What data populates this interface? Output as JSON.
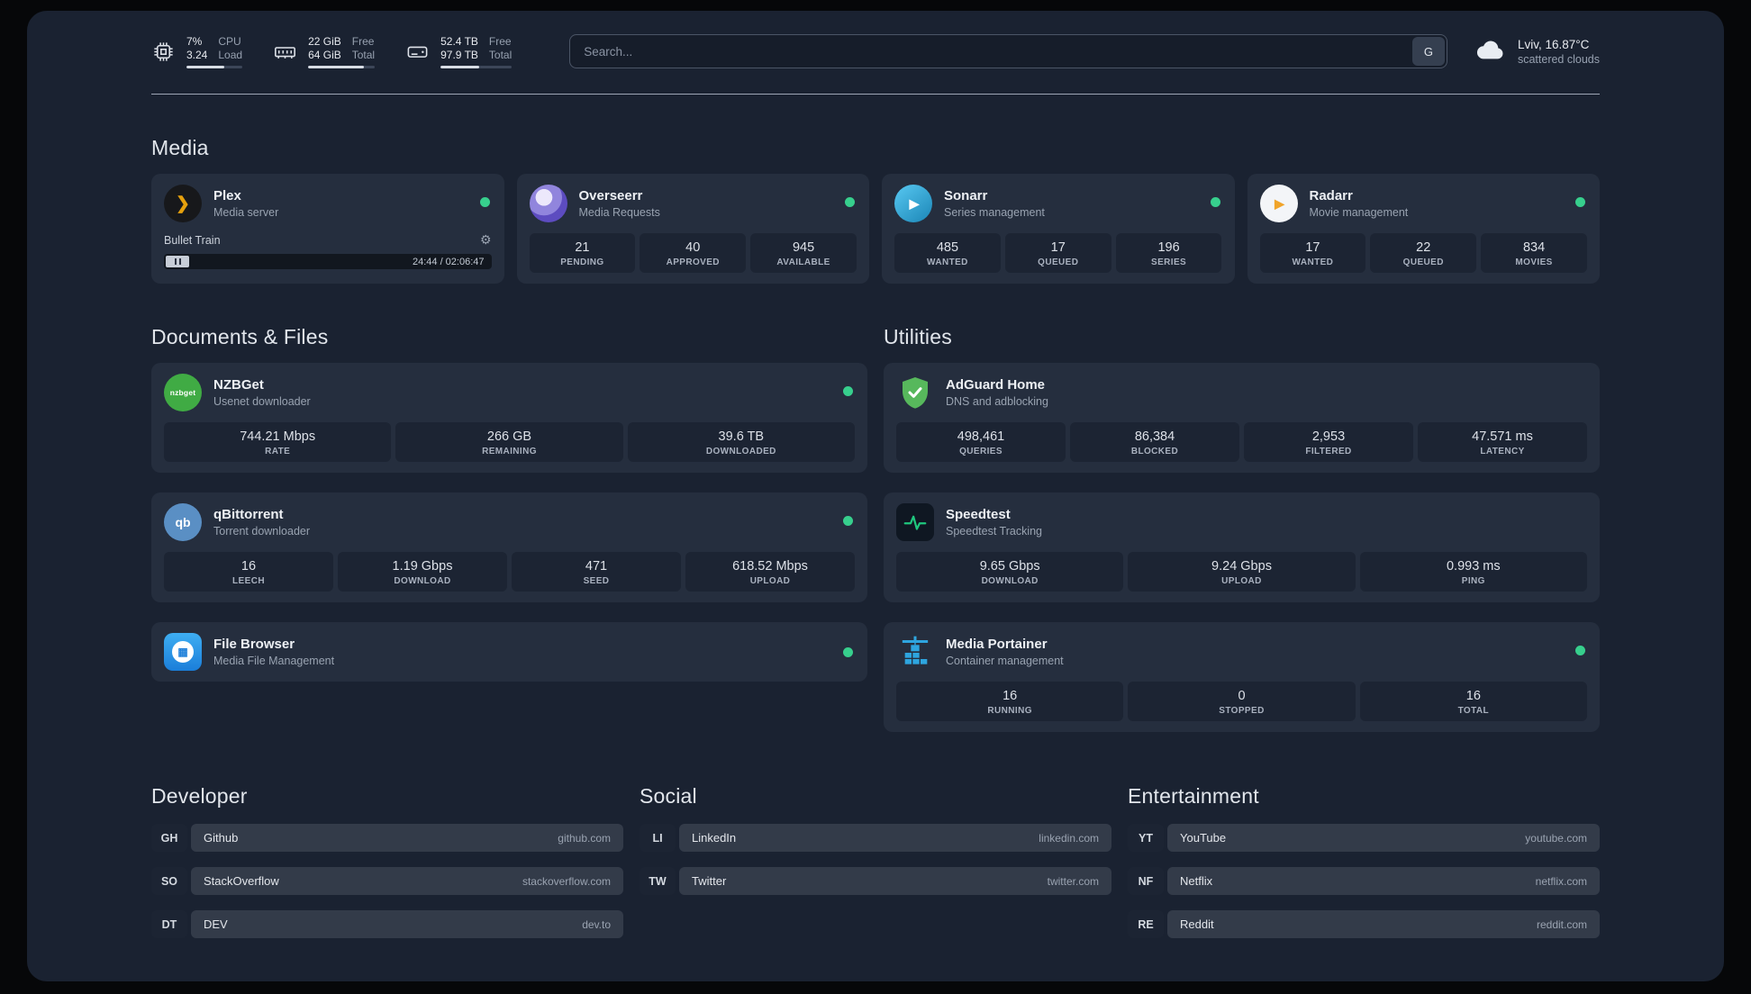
{
  "system": {
    "cpu": {
      "value1": "7%",
      "value2": "3.24",
      "label1": "CPU",
      "label2": "Load",
      "progress": 68
    },
    "memory": {
      "value1": "22 GiB",
      "value2": "64 GiB",
      "label1": "Free",
      "label2": "Total",
      "progress": 84
    },
    "disk": {
      "value1": "52.4 TB",
      "value2": "97.9 TB",
      "label1": "Free",
      "label2": "Total",
      "progress": 54
    }
  },
  "search": {
    "placeholder": "Search...",
    "button_label": "G"
  },
  "weather": {
    "location": "Lviv, 16.87°C",
    "condition": "scattered clouds"
  },
  "groups": {
    "media": {
      "title": "Media"
    },
    "documents": {
      "title": "Documents & Files"
    },
    "utilities": {
      "title": "Utilities"
    }
  },
  "services": {
    "plex": {
      "name": "Plex",
      "subtitle": "Media server",
      "player": {
        "track": "Bullet Train",
        "time": "24:44 / 02:06:47"
      }
    },
    "overseerr": {
      "name": "Overseerr",
      "subtitle": "Media Requests",
      "stats": [
        {
          "value": "21",
          "label": "PENDING"
        },
        {
          "value": "40",
          "label": "APPROVED"
        },
        {
          "value": "945",
          "label": "AVAILABLE"
        }
      ]
    },
    "sonarr": {
      "name": "Sonarr",
      "subtitle": "Series management",
      "stats": [
        {
          "value": "485",
          "label": "WANTED"
        },
        {
          "value": "17",
          "label": "QUEUED"
        },
        {
          "value": "196",
          "label": "SERIES"
        }
      ]
    },
    "radarr": {
      "name": "Radarr",
      "subtitle": "Movie management",
      "stats": [
        {
          "value": "17",
          "label": "WANTED"
        },
        {
          "value": "22",
          "label": "QUEUED"
        },
        {
          "value": "834",
          "label": "MOVIES"
        }
      ]
    },
    "nzbget": {
      "name": "NZBGet",
      "subtitle": "Usenet downloader",
      "stats": [
        {
          "value": "744.21 Mbps",
          "label": "RATE"
        },
        {
          "value": "266 GB",
          "label": "REMAINING"
        },
        {
          "value": "39.6 TB",
          "label": "DOWNLOADED"
        }
      ]
    },
    "qbittorrent": {
      "name": "qBittorrent",
      "subtitle": "Torrent downloader",
      "stats": [
        {
          "value": "16",
          "label": "LEECH"
        },
        {
          "value": "1.19 Gbps",
          "label": "DOWNLOAD"
        },
        {
          "value": "471",
          "label": "SEED"
        },
        {
          "value": "618.52 Mbps",
          "label": "UPLOAD"
        }
      ]
    },
    "filebrowser": {
      "name": "File Browser",
      "subtitle": "Media File Management"
    },
    "adguard": {
      "name": "AdGuard Home",
      "subtitle": "DNS and adblocking",
      "stats": [
        {
          "value": "498,461",
          "label": "QUERIES"
        },
        {
          "value": "86,384",
          "label": "BLOCKED"
        },
        {
          "value": "2,953",
          "label": "FILTERED"
        },
        {
          "value": "47.571 ms",
          "label": "LATENCY"
        }
      ]
    },
    "speedtest": {
      "name": "Speedtest",
      "subtitle": "Speedtest Tracking",
      "stats": [
        {
          "value": "9.65 Gbps",
          "label": "DOWNLOAD"
        },
        {
          "value": "9.24 Gbps",
          "label": "UPLOAD"
        },
        {
          "value": "0.993 ms",
          "label": "PING"
        }
      ]
    },
    "portainer": {
      "name": "Media Portainer",
      "subtitle": "Container management",
      "stats": [
        {
          "value": "16",
          "label": "RUNNING"
        },
        {
          "value": "0",
          "label": "STOPPED"
        },
        {
          "value": "16",
          "label": "TOTAL"
        }
      ]
    }
  },
  "bookmarks": {
    "developer": {
      "title": "Developer",
      "items": [
        {
          "abbr": "GH",
          "name": "Github",
          "url": "github.com"
        },
        {
          "abbr": "SO",
          "name": "StackOverflow",
          "url": "stackoverflow.com"
        },
        {
          "abbr": "DT",
          "name": "DEV",
          "url": "dev.to"
        }
      ]
    },
    "social": {
      "title": "Social",
      "items": [
        {
          "abbr": "LI",
          "name": "LinkedIn",
          "url": "linkedin.com"
        },
        {
          "abbr": "TW",
          "name": "Twitter",
          "url": "twitter.com"
        }
      ]
    },
    "entertainment": {
      "title": "Entertainment",
      "items": [
        {
          "abbr": "YT",
          "name": "YouTube",
          "url": "youtube.com"
        },
        {
          "abbr": "NF",
          "name": "Netflix",
          "url": "netflix.com"
        },
        {
          "abbr": "RE",
          "name": "Reddit",
          "url": "reddit.com"
        }
      ]
    }
  },
  "colors": {
    "status_online": "#37cf8d",
    "speedtest_line": "#1fc77e",
    "adguard_green": "#57b85c",
    "portainer_blue": "#2ea5df"
  }
}
